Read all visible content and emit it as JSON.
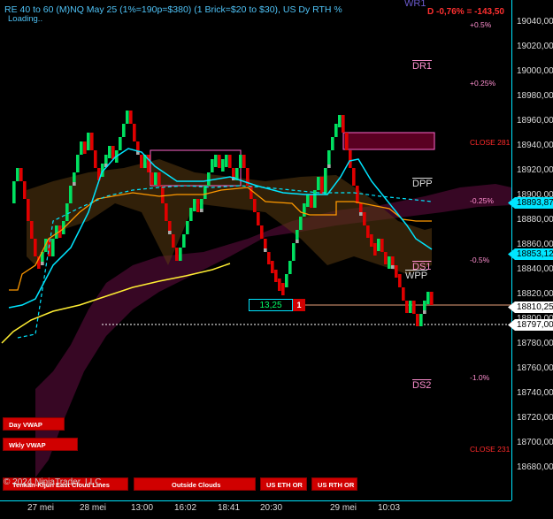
{
  "header": {
    "title": "RE 40 to 60 (M)NQ May 25 (1%=190p=$380) (1 Brick=$20 to $30), US Dy RTH %",
    "status": "Loading..",
    "wr_label": "WR1",
    "daily_change": "D -0,76% = -143,50"
  },
  "price_axis": {
    "ticks": [
      "19040,00",
      "19020,00",
      "19000,00",
      "18980,00",
      "18960,00",
      "18940,00",
      "18920,00",
      "18900,00",
      "18880,00",
      "18860,00",
      "18840,00",
      "18820,00",
      "18800,00",
      "18780,00",
      "18760,00",
      "18740,00",
      "18720,00",
      "18700,00",
      "18680,00"
    ],
    "flags": [
      {
        "label": "18893,87",
        "color": "#00e5ff",
        "text_color": "#000000"
      },
      {
        "label": "18853,12",
        "color": "#00e5ff",
        "text_color": "#000000"
      },
      {
        "label": "18810,25",
        "color": "#ffffff",
        "text_color": "#000000"
      },
      {
        "label": "18797,00",
        "color": "#ffffff",
        "text_color": "#000000"
      }
    ]
  },
  "percent_labels": [
    "+0.5%",
    "+0.25%",
    "-0.25%",
    "-0.5%",
    "-1.0%"
  ],
  "close_labels": [
    "CLOSE 281",
    "CLOSE 231"
  ],
  "levels": [
    "DR1",
    "DPP",
    "DS1",
    "WPP",
    "DS2"
  ],
  "renko_box": {
    "value": "13,25",
    "count": "1"
  },
  "buttons": {
    "day_vwap": "Day VWAP",
    "wkly_vwap": "Wkly VWAP",
    "cloud_lines": "Tenkan-Kijun East Cloud Lines",
    "outside_clouds": "Outside Clouds",
    "us_eth_or": "US ETH OR",
    "us_rth_or": "US RTH OR"
  },
  "copyright": "© 2024 NinjaTrader, LLC",
  "time_axis": [
    "27 mei",
    "28 mei",
    "13:00",
    "16:02",
    "18:41",
    "20:30",
    "29 mei",
    "10:03"
  ],
  "colors": {
    "up_brick": "#00e060",
    "down_brick": "#e00000",
    "axis": "#00e5ff",
    "kijun": "#ff9900",
    "tenkan": "#00e5ff",
    "vwap": "#ffee33",
    "cloud": "#5a0a3a"
  }
}
